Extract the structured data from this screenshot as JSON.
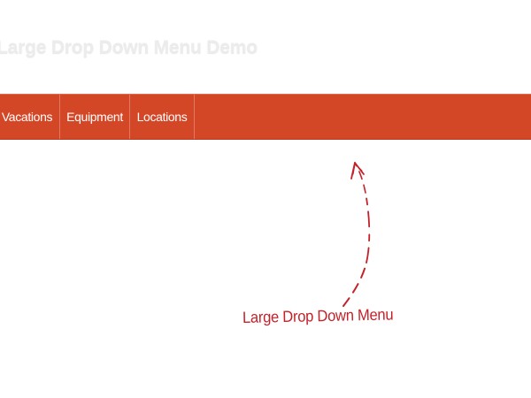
{
  "header": {
    "title": "Large Drop Down Menu Demo"
  },
  "menu": {
    "items": [
      {
        "label": "Vacations"
      },
      {
        "label": "Equipment"
      },
      {
        "label": "Locations"
      }
    ]
  },
  "annotation": {
    "text": "Large Drop Down Menu"
  },
  "colors": {
    "menu_background": "#d34726",
    "menu_text": "#ffffff",
    "title_text": "#ececec",
    "annotation_red": "#c42129"
  },
  "icons": {
    "annotation_pointer": "hand-drawn-arrow-icon"
  }
}
